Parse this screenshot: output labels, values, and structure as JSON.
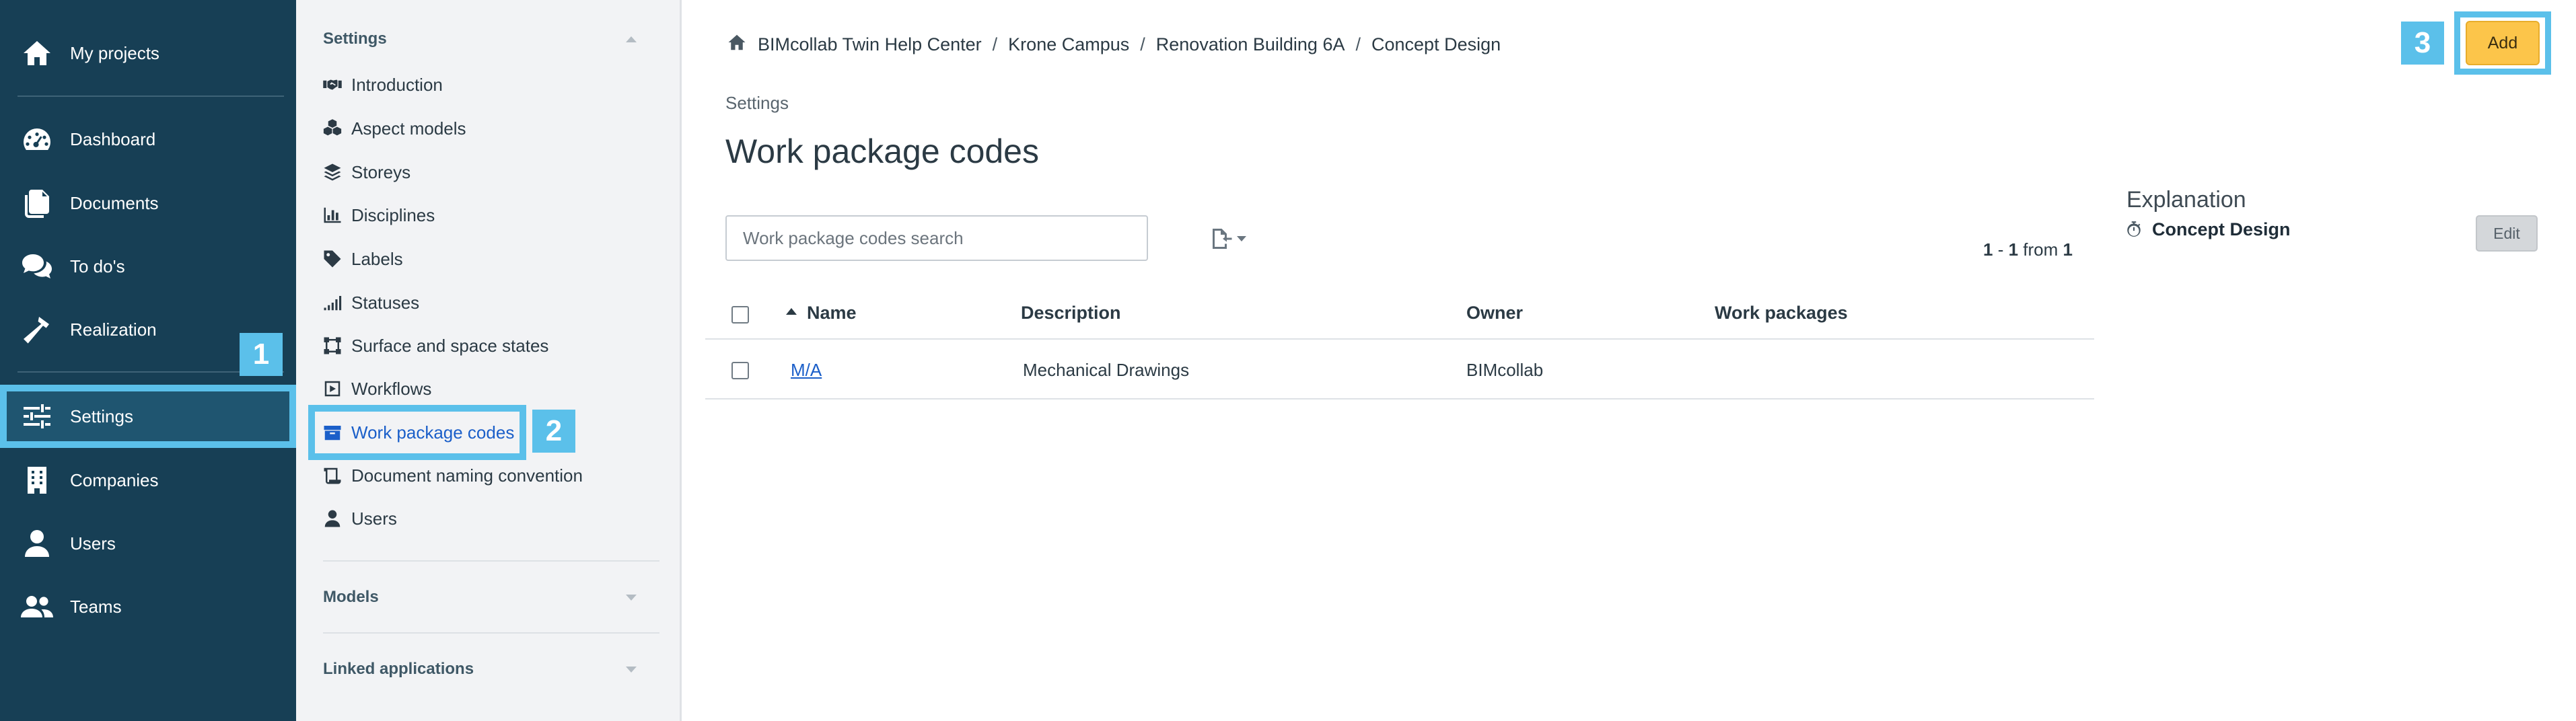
{
  "nav": {
    "items": [
      {
        "label": "My projects",
        "icon": "home-icon"
      },
      {
        "label": "Dashboard",
        "icon": "dashboard-icon"
      },
      {
        "label": "Documents",
        "icon": "documents-icon"
      },
      {
        "label": "To do's",
        "icon": "chat-icon"
      },
      {
        "label": "Realization",
        "icon": "hammer-icon"
      },
      {
        "label": "Settings",
        "icon": "sliders-icon",
        "active": true
      },
      {
        "label": "Companies",
        "icon": "building-icon"
      },
      {
        "label": "Users",
        "icon": "user-icon"
      },
      {
        "label": "Teams",
        "icon": "users-icon"
      }
    ]
  },
  "subnav": {
    "settings_header": "Settings",
    "items": [
      {
        "label": "Introduction",
        "icon": "handshake-icon"
      },
      {
        "label": "Aspect models",
        "icon": "cubes-icon"
      },
      {
        "label": "Storeys",
        "icon": "layers-icon"
      },
      {
        "label": "Disciplines",
        "icon": "chart-icon"
      },
      {
        "label": "Labels",
        "icon": "tag-icon"
      },
      {
        "label": "Statuses",
        "icon": "signal-icon"
      },
      {
        "label": "Surface and space states",
        "icon": "vector-square-icon"
      },
      {
        "label": "Workflows",
        "icon": "play-square-icon"
      },
      {
        "label": "Work package codes",
        "icon": "box-icon",
        "active": true
      },
      {
        "label": "Document naming convention",
        "icon": "scroll-icon"
      },
      {
        "label": "Users",
        "icon": "user-icon"
      }
    ],
    "models_header": "Models",
    "linked_header": "Linked applications"
  },
  "callouts": {
    "one": "1",
    "two": "2",
    "three": "3"
  },
  "breadcrumb": {
    "items": [
      "BIMcollab Twin Help Center",
      "Krone Campus",
      "Renovation Building 6A",
      "Concept Design"
    ],
    "separator": "/"
  },
  "toolbar": {
    "add_label": "Add"
  },
  "page": {
    "section": "Settings",
    "title": "Work package codes"
  },
  "search": {
    "placeholder": "Work package codes search",
    "value": ""
  },
  "pagination": {
    "start": "1",
    "dash": " - ",
    "end": "1",
    "from_word": " from ",
    "total": "1"
  },
  "table": {
    "headers": {
      "name": "Name",
      "description": "Description",
      "owner": "Owner",
      "work_packages": "Work packages"
    },
    "rows": [
      {
        "name": "M/A",
        "description": "Mechanical Drawings",
        "owner": "BIMcollab",
        "work_packages": ""
      }
    ]
  },
  "explanation": {
    "title": "Explanation",
    "item": "Concept Design",
    "edit_label": "Edit"
  },
  "colors": {
    "nav_bg": "#173f55",
    "accent_callout": "#5bc0ea",
    "add_button": "#fcc54a",
    "link": "#1b5fc9"
  }
}
